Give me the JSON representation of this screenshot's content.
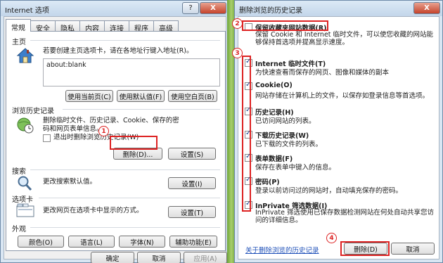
{
  "left_window": {
    "title": "Internet 选项",
    "help_button": "?",
    "close_button": "X",
    "tabs": [
      "常规",
      "安全",
      "隐私",
      "内容",
      "连接",
      "程序",
      "高级"
    ],
    "home": {
      "header": "主页",
      "desc": "若要创建主页选项卡，请在各地址行键入地址(R)。",
      "value": "about:blank",
      "buttons": [
        "使用当前页(C)",
        "使用默认值(F)",
        "使用空白页(B)"
      ]
    },
    "history": {
      "header": "浏览历史记录",
      "desc": "删除临时文件、历史记录、Cookie、保存的密码和网页表单信息。",
      "checkbox_label": "退出时删除浏览历史记录(W)",
      "delete_button": "删除(D)...",
      "settings_button": "设置(S)"
    },
    "search": {
      "header": "搜索",
      "desc": "更改搜索默认值。",
      "settings_button": "设置(I)"
    },
    "tabs_group": {
      "header": "选项卡",
      "desc": "更改网页在选项卡中显示的方式。",
      "settings_button": "设置(T)"
    },
    "appearance": {
      "header": "外观",
      "buttons": [
        "颜色(O)",
        "语言(L)",
        "字体(N)",
        "辅助功能(E)"
      ]
    },
    "footer": [
      "确定",
      "取消",
      "应用(A)"
    ],
    "badge": "1"
  },
  "right_window": {
    "title": "删除浏览的历史记录",
    "close_button": "X",
    "favorites": {
      "label": "保留收藏夹网站数据(R)",
      "desc": "保留 Cookie 和 Internet 临时文件，可以使您收藏的网站能够保持首选项并提高显示速度。",
      "checked": false
    },
    "items": [
      {
        "label": "Internet 临时文件(T)",
        "desc": "为快速查看而保存的网页、图像和媒体的副本",
        "checked": true
      },
      {
        "label": "Cookie(O)",
        "desc": "网站存储在计算机上的文件，以保存如登录信息等首选项。",
        "checked": true
      },
      {
        "label": "历史记录(H)",
        "desc": "已访问网站的列表。",
        "checked": true
      },
      {
        "label": "下载历史记录(W)",
        "desc": "已下载的文件的列表。",
        "checked": true
      },
      {
        "label": "表单数据(F)",
        "desc": "保存在表单中键入的信息。",
        "checked": true
      },
      {
        "label": "密码(P)",
        "desc": "登录以前访问过的网站时，自动填充保存的密码。",
        "checked": true
      },
      {
        "label": "InPrivate 筛选数据(I)",
        "desc": "InPrivate 筛选使用已保存数据检测网站在何处自动共享您访问的详细信息。",
        "checked": true
      }
    ],
    "about_link": "关于删除浏览的历史记录",
    "delete_button": "删除(D)",
    "cancel_button": "取消",
    "badges": [
      "2",
      "3",
      "4"
    ]
  },
  "colors": {
    "highlight": "#dd2222",
    "link": "#1d4fb8",
    "title_bar": "#c3d6ea"
  },
  "icons": [
    "home-icon",
    "globe-history-icon",
    "magnifier-icon",
    "tabs-window-icon",
    "checkmark-icon"
  ]
}
